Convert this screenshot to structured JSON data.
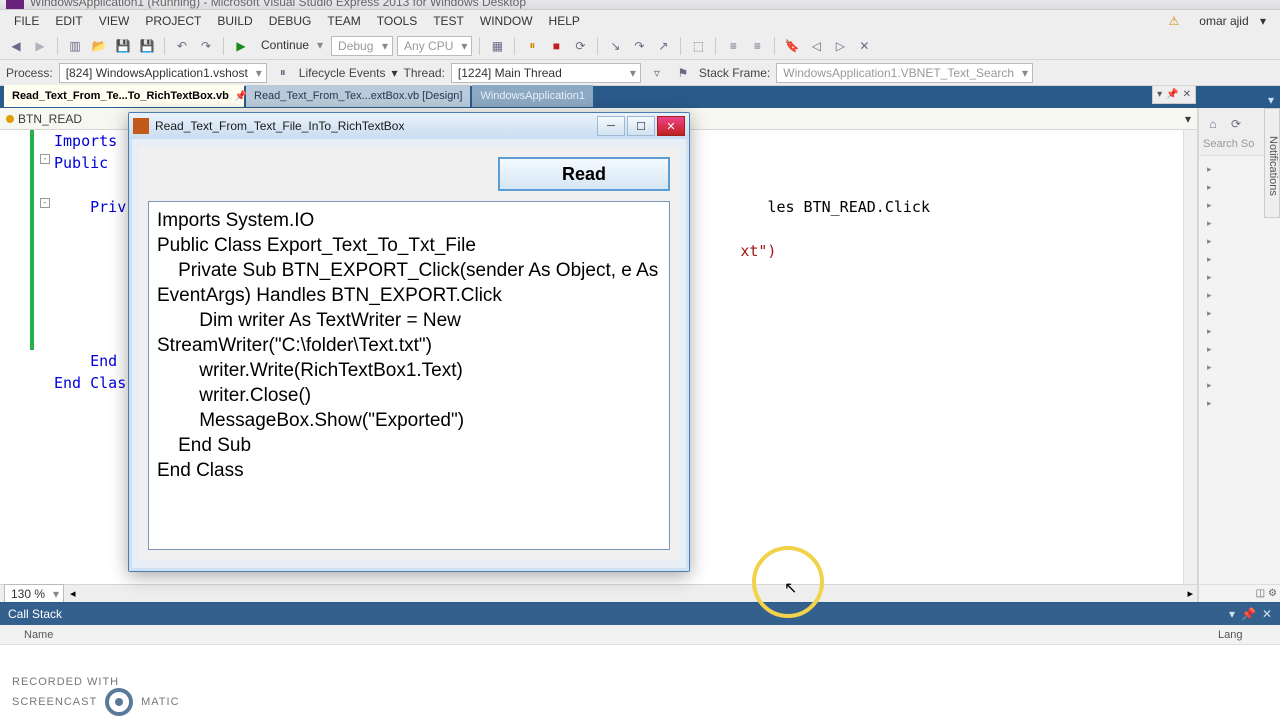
{
  "titlebar": "WindowsApplication1 (Running) - Microsoft Visual Studio Express 2013 for Windows Desktop",
  "menu": [
    "FILE",
    "EDIT",
    "VIEW",
    "PROJECT",
    "BUILD",
    "DEBUG",
    "TEAM",
    "TOOLS",
    "TEST",
    "WINDOW",
    "HELP"
  ],
  "user": "omar ajid",
  "toolbar": {
    "continue": "Continue",
    "config": "Debug",
    "platform": "Any CPU"
  },
  "debugbar": {
    "process_label": "Process:",
    "process": "[824] WindowsApplication1.vshost",
    "lifecycle_label": "Lifecycle Events",
    "thread_label": "Thread:",
    "thread": "[1224] Main Thread",
    "stackframe_label": "Stack Frame:",
    "stackframe": "WindowsApplication1.VBNET_Text_Search"
  },
  "tabs": [
    {
      "label": "Read_Text_From_Te...To_RichTextBox.vb",
      "active": true
    },
    {
      "label": "Read_Text_From_Tex...extBox.vb [Design]",
      "active": false
    },
    {
      "label": "WindowsApplication1",
      "active": false
    }
  ],
  "nav": {
    "left": "BTN_READ"
  },
  "code_behind": {
    "line1": "Imports",
    "line2": "Public ",
    "line3": "    Priv",
    "line4_tail": "les BTN_READ.Click",
    "line5_tail": "xt\")",
    "line_end1": "    End",
    "line_end2": "End Clas"
  },
  "zoom": "130 %",
  "solution": {
    "search": "Search So"
  },
  "callstack": {
    "title": "Call Stack",
    "col1": "Name",
    "col2": "Lang"
  },
  "watermark": {
    "l1": "Recorded with",
    "l2a": "Screencast",
    "l2b": "Matic"
  },
  "notifications": "Notifications",
  "app": {
    "title": "Read_Text_From_Text_File_InTo_RichTextBox",
    "read_btn": "Read",
    "content": "Imports System.IO\nPublic Class Export_Text_To_Txt_File\n    Private Sub BTN_EXPORT_Click(sender As Object, e As EventArgs) Handles BTN_EXPORT.Click\n        Dim writer As TextWriter = New StreamWriter(\"C:\\folder\\Text.txt\")\n        writer.Write(RichTextBox1.Text)\n        writer.Close()\n        MessageBox.Show(\"Exported\")\n    End Sub\nEnd Class"
  }
}
